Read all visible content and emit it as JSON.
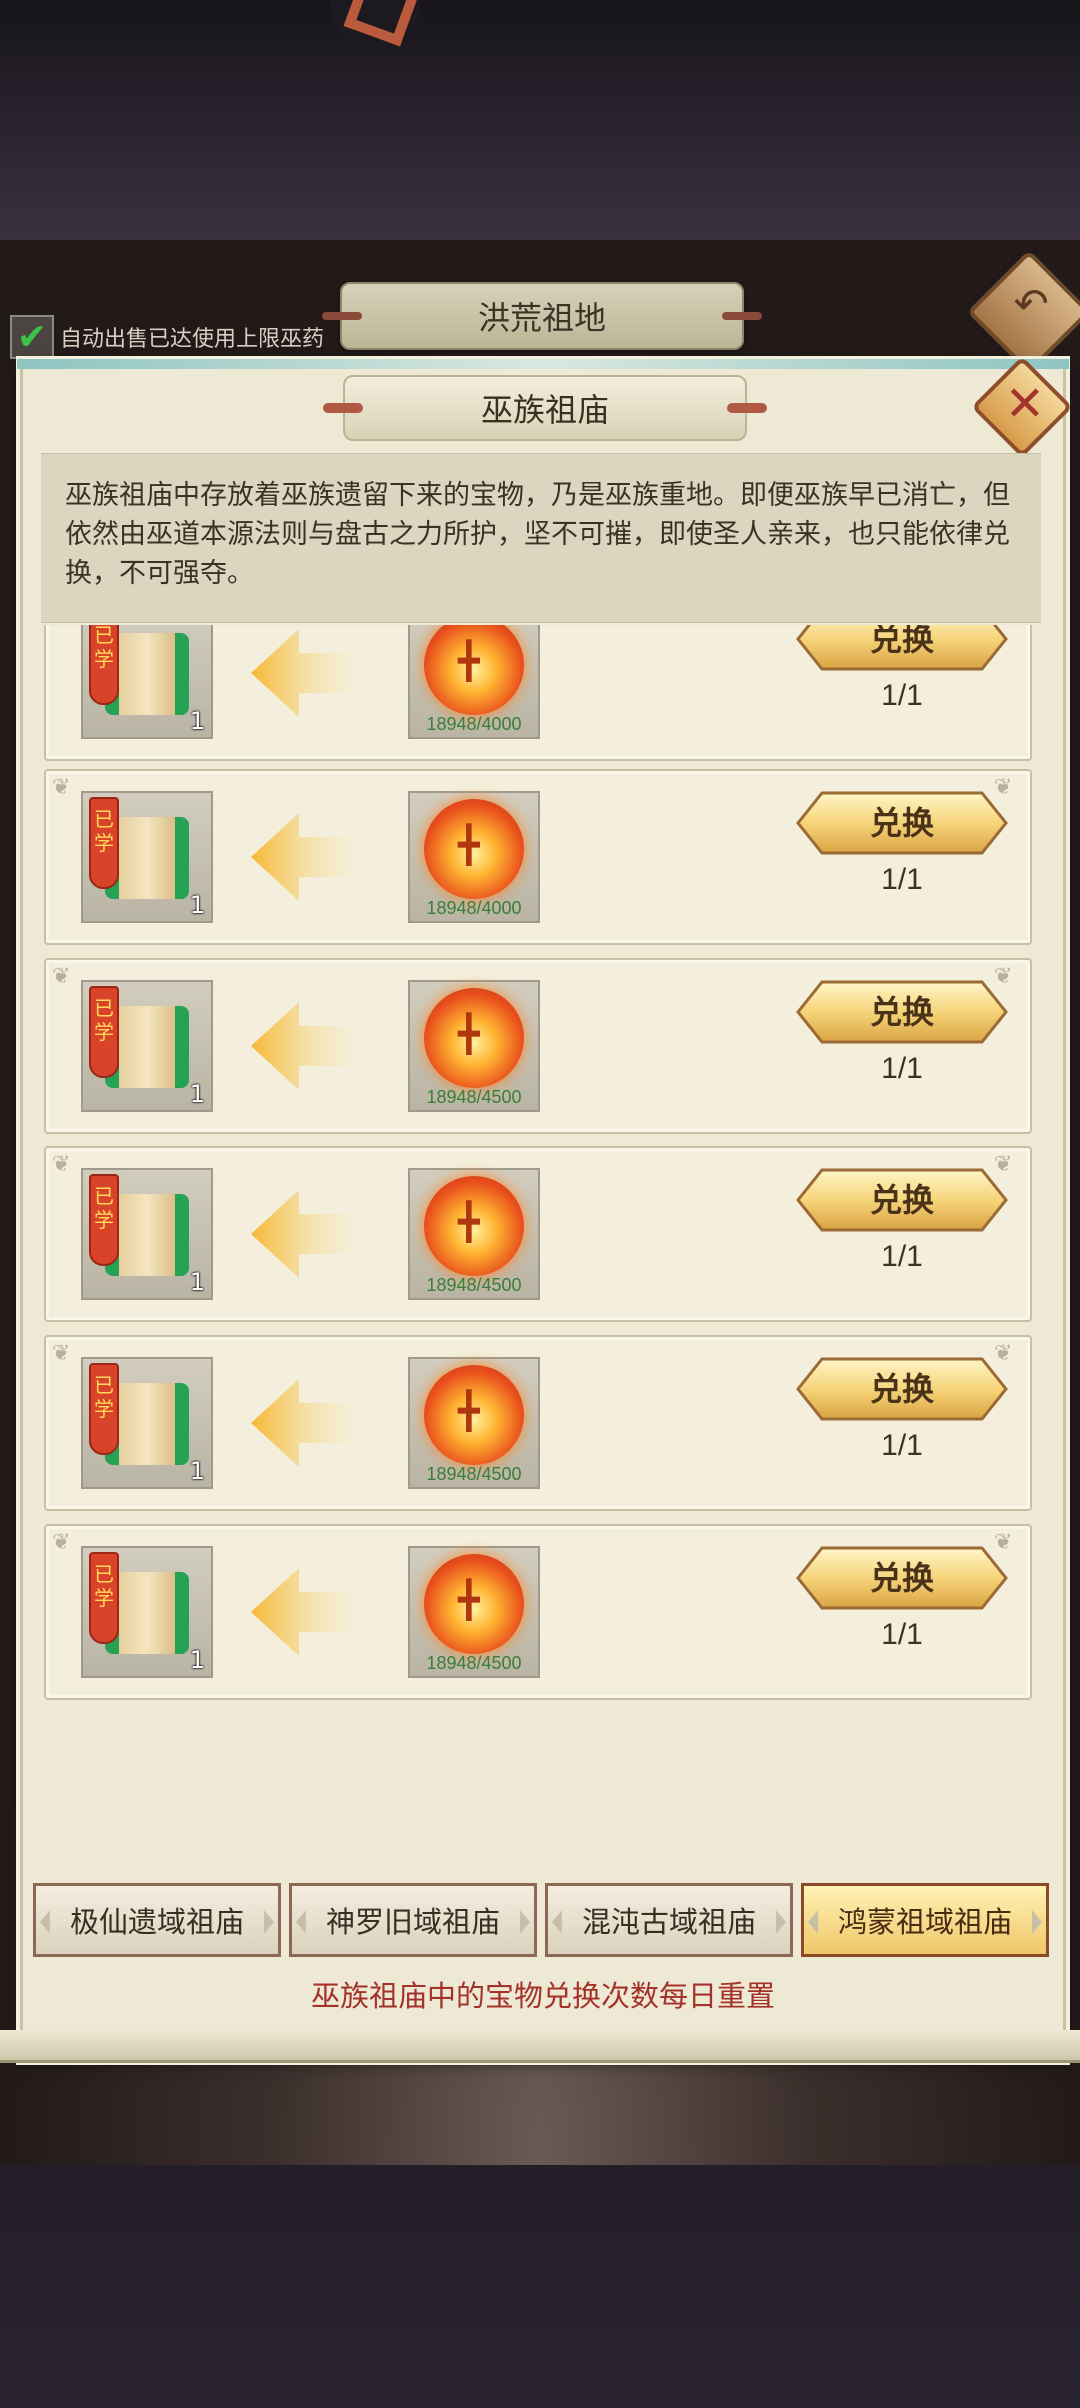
{
  "window": {
    "background_title": "洪荒祖地",
    "auto_sell_label": "自动出售已达使用上限巫药",
    "auto_sell_checked": true
  },
  "panel": {
    "title": "巫族祖庙",
    "description": "巫族祖庙中存放着巫族遗留下来的宝物，乃是巫族重地。即便巫族早已消亡，但依然由巫道本源法则与盘古之力所护，坚不可摧，即使圣人亲来，也只能依律兑换，不可强夺。",
    "close_icon": "close-icon"
  },
  "items": [
    {
      "learned_tag": "已学",
      "quantity": "1",
      "fire_count": "18948/4000",
      "button_label": "兑换",
      "limit": "1/1"
    },
    {
      "learned_tag": "已学",
      "quantity": "1",
      "fire_count": "18948/4000",
      "button_label": "兑换",
      "limit": "1/1"
    },
    {
      "learned_tag": "已学",
      "quantity": "1",
      "fire_count": "18948/4500",
      "button_label": "兑换",
      "limit": "1/1"
    },
    {
      "learned_tag": "已学",
      "quantity": "1",
      "fire_count": "18948/4500",
      "button_label": "兑换",
      "limit": "1/1"
    },
    {
      "learned_tag": "已学",
      "quantity": "1",
      "fire_count": "18948/4500",
      "button_label": "兑换",
      "limit": "1/1"
    },
    {
      "learned_tag": "已学",
      "quantity": "1",
      "fire_count": "18948/4500",
      "button_label": "兑换",
      "limit": "1/1"
    }
  ],
  "tabs": [
    {
      "label": "极仙遗域祖庙",
      "active": false
    },
    {
      "label": "神罗旧域祖庙",
      "active": false
    },
    {
      "label": "混沌古域祖庙",
      "active": false
    },
    {
      "label": "鸿蒙祖域祖庙",
      "active": true
    }
  ],
  "footer_note": "巫族祖庙中的宝物兑换次数每日重置",
  "colors": {
    "panel_bg": "#eee9d4",
    "button_gold": "#f0c66a",
    "note_red": "#a4322a",
    "count_green": "#3c7d38"
  }
}
